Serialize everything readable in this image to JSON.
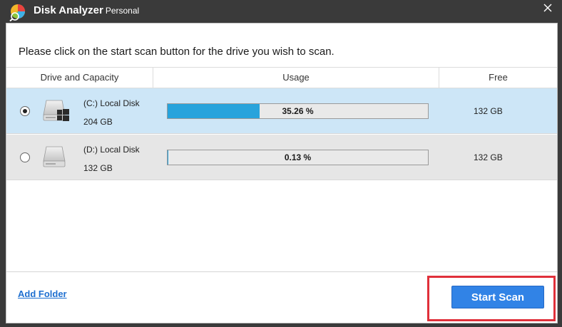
{
  "window": {
    "title": "Disk Analyzer",
    "edition": "Personal",
    "close_glyph": "✕"
  },
  "instruction": "Please click on the start scan button for the drive you wish to scan.",
  "table": {
    "columns": [
      "Drive and Capacity",
      "Usage",
      "Free"
    ],
    "rows": [
      {
        "name": "(C:)  Local Disk",
        "capacity": "204 GB",
        "usage_label": "35.26 %",
        "usage_fraction": 0.3526,
        "free": "132 GB",
        "selected": true,
        "icon": "windows-drive-icon"
      },
      {
        "name": "(D:)  Local Disk",
        "capacity": "132 GB",
        "usage_label": "0.13 %",
        "usage_fraction": 0.0013,
        "free": "132 GB",
        "selected": false,
        "icon": "drive-icon"
      }
    ]
  },
  "footer": {
    "add_folder": "Add Folder",
    "start_scan": "Start Scan"
  },
  "colors": {
    "accent": "#3183e6",
    "selected_row": "#cde6f7",
    "usage_fill": "#27a3dc",
    "highlight": "#e0303a",
    "titlebar": "#3a3a3a"
  }
}
